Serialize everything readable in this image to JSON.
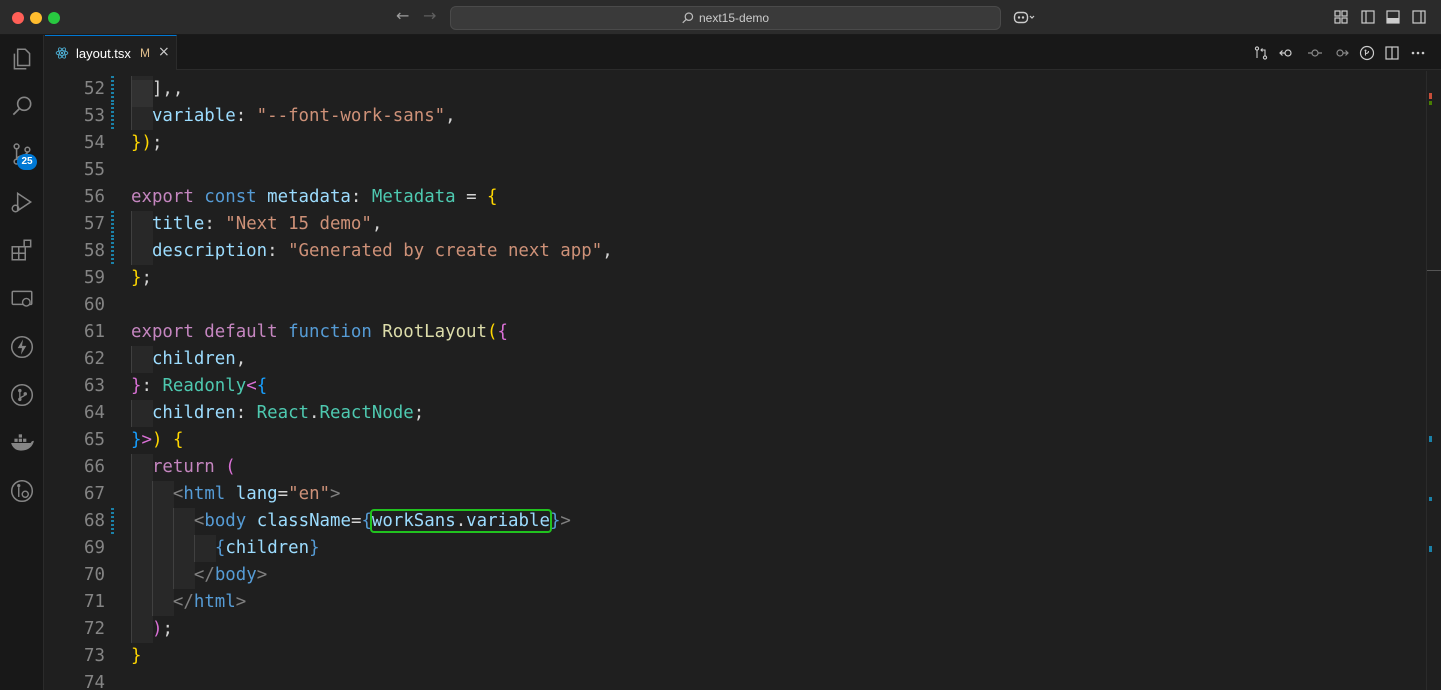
{
  "window": {
    "title": "next15-demo"
  },
  "activity_bar": {
    "source_control_badge": "25",
    "icons": [
      "explorer-icon",
      "search-icon",
      "source-control-icon",
      "run-debug-icon",
      "extensions-icon",
      "remote-explorer-icon",
      "lightning-icon",
      "git-graph-icon",
      "docker-icon",
      "gitlens-icon"
    ]
  },
  "tab": {
    "name": "layout.tsx",
    "status": "M",
    "close": "×"
  },
  "lines": [
    {
      "n": "52",
      "segs": [
        [
          "p",
          "],"
        ],
        [
          "p",
          ","
        ]
      ]
    },
    {
      "n": "53",
      "segs": [
        [
          "var",
          "variable"
        ],
        [
          "p",
          ": "
        ],
        [
          "str",
          "\"--font-work-sans\""
        ],
        [
          "p",
          ","
        ]
      ]
    },
    {
      "n": "54",
      "segs": [
        [
          "b1",
          "}"
        ],
        [
          "b1",
          ")"
        ],
        [
          "p",
          ";"
        ]
      ]
    },
    {
      "n": "55",
      "segs": []
    },
    {
      "n": "56",
      "segs": [
        [
          "kw",
          "export "
        ],
        [
          "st",
          "const "
        ],
        [
          "var",
          "metadata"
        ],
        [
          "p",
          ": "
        ],
        [
          "ty",
          "Metadata"
        ],
        [
          "p",
          " = "
        ],
        [
          "b1",
          "{"
        ]
      ]
    },
    {
      "n": "57",
      "segs": [
        [
          "var",
          "title"
        ],
        [
          "p",
          ": "
        ],
        [
          "str",
          "\"Next 15 demo\""
        ],
        [
          "p",
          ","
        ]
      ]
    },
    {
      "n": "58",
      "segs": [
        [
          "var",
          "description"
        ],
        [
          "p",
          ": "
        ],
        [
          "str",
          "\"Generated by create next app\""
        ],
        [
          "p",
          ","
        ]
      ]
    },
    {
      "n": "59",
      "segs": [
        [
          "b1",
          "}"
        ],
        [
          "p",
          ";"
        ]
      ]
    },
    {
      "n": "60",
      "segs": []
    },
    {
      "n": "61",
      "segs": [
        [
          "kw",
          "export default "
        ],
        [
          "st",
          "function "
        ],
        [
          "fn",
          "RootLayout"
        ],
        [
          "b1",
          "("
        ],
        [
          "b2",
          "{"
        ]
      ]
    },
    {
      "n": "62",
      "segs": [
        [
          "var",
          "children"
        ],
        [
          "p",
          ","
        ]
      ]
    },
    {
      "n": "63",
      "segs": [
        [
          "b2",
          "}"
        ],
        [
          "p",
          ": "
        ],
        [
          "ty",
          "Readonly"
        ],
        [
          "b2",
          "<"
        ],
        [
          "b3",
          "{"
        ]
      ]
    },
    {
      "n": "64",
      "segs": [
        [
          "var",
          "children"
        ],
        [
          "p",
          ": "
        ],
        [
          "ty",
          "React"
        ],
        [
          "p",
          "."
        ],
        [
          "ty",
          "ReactNode"
        ],
        [
          "p",
          ";"
        ]
      ]
    },
    {
      "n": "65",
      "segs": [
        [
          "b3",
          "}"
        ],
        [
          "b2",
          ">"
        ],
        [
          "b1",
          ")"
        ],
        [
          "p",
          " "
        ],
        [
          "b1",
          "{"
        ]
      ]
    },
    {
      "n": "66",
      "segs": [
        [
          "kw",
          "return "
        ],
        [
          "b2",
          "("
        ]
      ]
    },
    {
      "n": "67",
      "segs": [
        [
          "tagb",
          "<"
        ],
        [
          "tag",
          "html "
        ],
        [
          "attr",
          "lang"
        ],
        [
          "p",
          "="
        ],
        [
          "str",
          "\"en\""
        ],
        [
          "tagb",
          ">"
        ]
      ]
    },
    {
      "n": "68",
      "segs": [
        [
          "tagb",
          "<"
        ],
        [
          "tag",
          "body "
        ],
        [
          "attr",
          "className"
        ],
        [
          "p",
          "="
        ],
        [
          "st",
          "{"
        ],
        [
          "HL",
          "workSans.variable"
        ],
        [
          "st",
          "}"
        ],
        [
          "tagb",
          ">"
        ]
      ]
    },
    {
      "n": "69",
      "segs": [
        [
          "st",
          "{"
        ],
        [
          "var",
          "children"
        ],
        [
          "st",
          "}"
        ]
      ]
    },
    {
      "n": "70",
      "segs": [
        [
          "tagb",
          "</"
        ],
        [
          "tag",
          "body"
        ],
        [
          "tagb",
          ">"
        ]
      ]
    },
    {
      "n": "71",
      "segs": [
        [
          "tagb",
          "</"
        ],
        [
          "tag",
          "html"
        ],
        [
          "tagb",
          ">"
        ]
      ]
    },
    {
      "n": "72",
      "segs": [
        [
          "b2",
          ")"
        ],
        [
          "p",
          ";"
        ]
      ]
    },
    {
      "n": "73",
      "segs": [
        [
          "b1",
          "}"
        ]
      ]
    },
    {
      "n": "74",
      "segs": []
    }
  ],
  "highlight": {
    "object": "workSans",
    "dot": ".",
    "property": "variable"
  },
  "colors": {
    "accent": "#0078d4",
    "highlight_box": "#21c21f",
    "modified_gutter": "#1b81a8"
  }
}
